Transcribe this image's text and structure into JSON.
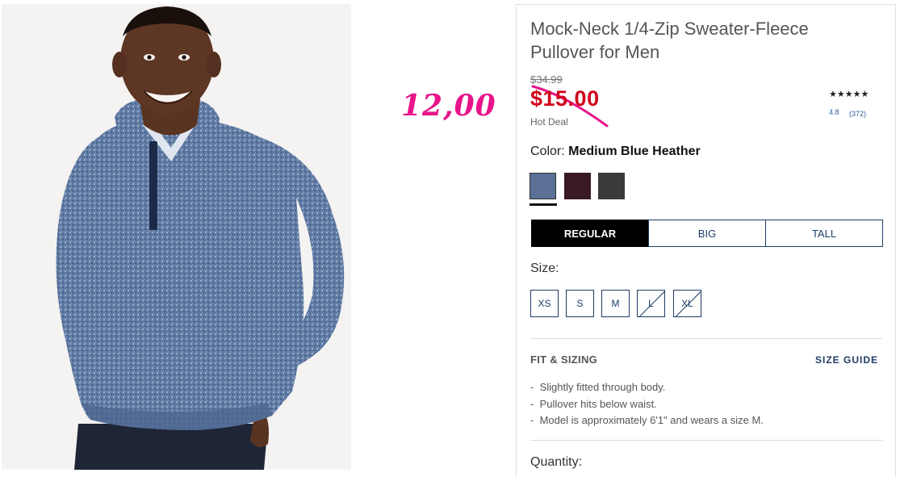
{
  "annotation": {
    "handwritten_price": "12,00"
  },
  "product": {
    "title": "Mock-Neck 1/4-Zip Sweater-Fleece Pullover for Men",
    "original_price": "$34.99",
    "sale_price": "$15.00",
    "deal_label": "Hot Deal",
    "stars": "★★★★★",
    "rating": "4.8",
    "review_count": "(372)"
  },
  "color": {
    "label": "Color:",
    "selected": "Medium Blue Heather",
    "swatches": [
      {
        "name": "Medium Blue Heather",
        "hex": "#5a7096"
      },
      {
        "name": "Burgundy",
        "hex": "#3a1a22"
      },
      {
        "name": "Charcoal",
        "hex": "#3a3a3a"
      }
    ]
  },
  "fit_tabs": [
    "REGULAR",
    "BIG",
    "TALL"
  ],
  "size": {
    "label": "Size:",
    "options": [
      {
        "label": "XS",
        "available": true
      },
      {
        "label": "S",
        "available": true
      },
      {
        "label": "M",
        "available": true
      },
      {
        "label": "L",
        "available": false
      },
      {
        "label": "XL",
        "available": false
      }
    ]
  },
  "fit_sizing": {
    "heading": "FIT & SIZING",
    "guide_link": "SIZE GUIDE",
    "bullets": [
      "Slightly fitted through body.",
      "Pullover hits below waist.",
      "Model is approximately 6'1\" and wears a size M."
    ]
  },
  "quantity": {
    "label": "Quantity:"
  },
  "colors": {
    "sale_red": "#d0021b",
    "annotation_pink": "#e8158a",
    "navy": "#1f3d66"
  }
}
